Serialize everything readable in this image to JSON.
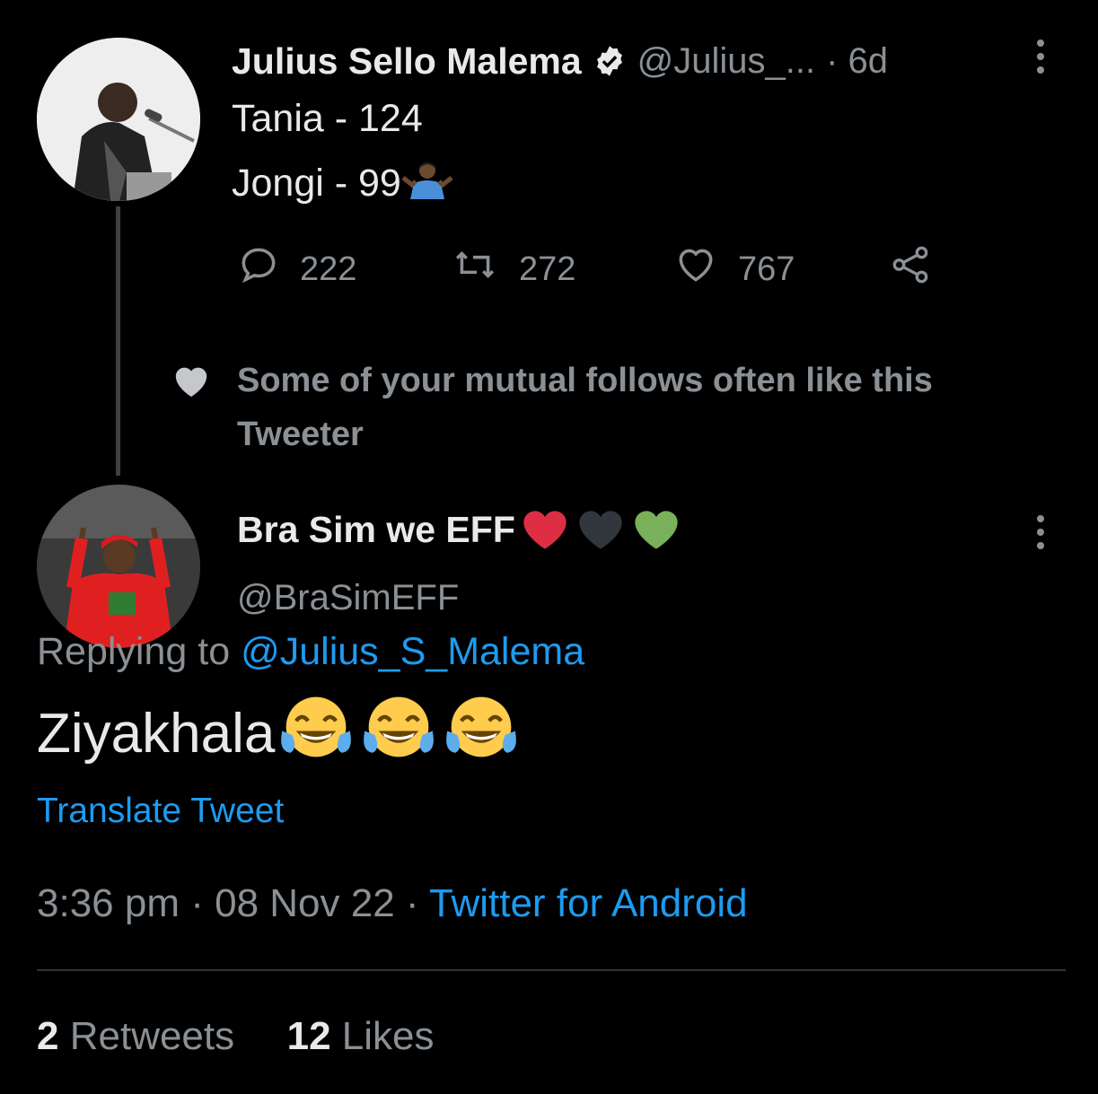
{
  "parent_tweet": {
    "author_name": "Julius Sello Malema",
    "handle": "@Julius_...",
    "time": "· 6d",
    "line1": "Tania - 124",
    "line2": "Jongi - 99",
    "line2_emoji": "person-shrugging-emoji",
    "reply_count": "222",
    "retweet_count": "272",
    "like_count": "767",
    "icons": [
      "reply-icon",
      "retweet-icon",
      "like-icon",
      "share-icon",
      "verified-badge-icon",
      "more-icon"
    ]
  },
  "social_context": {
    "text": "Some of your mutual follows often like this Tweeter",
    "icon": "heart-icon"
  },
  "main_tweet": {
    "author_name": "Bra Sim we EFF",
    "name_emojis": [
      "red-heart-emoji",
      "black-heart-emoji",
      "green-heart-emoji"
    ],
    "handle": "@BraSimEFF",
    "replying_prefix": "Replying to",
    "replying_to": "@Julius_S_Malema",
    "text": "Ziyakhala",
    "text_emojis": [
      "tears-of-joy-emoji",
      "tears-of-joy-emoji",
      "tears-of-joy-emoji"
    ],
    "translate_label": "Translate Tweet",
    "time": "3:36 pm",
    "sep1": "·",
    "date": "08 Nov 22",
    "sep2": "·",
    "source": "Twitter for Android",
    "retweets_count": "2",
    "retweets_label": "Retweets",
    "likes_count": "12",
    "likes_label": "Likes"
  },
  "colors": {
    "background": "#000000",
    "text": "#e7e9ea",
    "muted": "#8b9095",
    "link": "#1d9bf0",
    "red_heart": "#dd2e44",
    "black_heart": "#31373d",
    "green_heart": "#78b159"
  }
}
